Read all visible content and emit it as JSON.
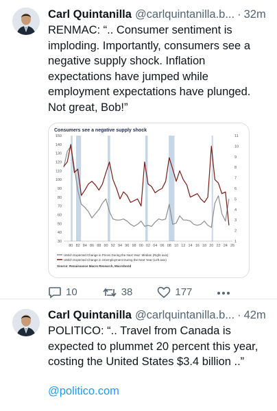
{
  "tweets": [
    {
      "author": "Carl Quintanilla",
      "handle": "@carlquintanilla.b...",
      "separator": "·",
      "time": "32m",
      "text": "RENMAC: “.. Consumer sentiment is imploding. Importantly, consumers see a negative supply shock. Inflation expectations have jumped while employment expectations have plunged. Not great, Bob!”",
      "stats": {
        "replies": "10",
        "reposts": "38",
        "likes": "177"
      },
      "more_icon": "more-dots-icon"
    },
    {
      "author": "Carl Quintanilla",
      "handle": "@carlquintanilla.b...",
      "separator": "·",
      "time": "42m",
      "text": "POLITICO: “.. Travel from Canada is expected to plummet 20 percent this year, costing the United States $3.4 billion ..”",
      "link": "@politico.com"
    }
  ],
  "chart_data": {
    "type": "line",
    "title": "Consumers see a negative supply shock",
    "x_tick_labels": [
      "80",
      "82",
      "84",
      "86",
      "88",
      "90",
      "92",
      "94",
      "96",
      "98",
      "00",
      "02",
      "04",
      "06",
      "08",
      "10",
      "12",
      "14",
      "16",
      "18",
      "20",
      "22",
      "24",
      "26"
    ],
    "left_axis": {
      "ticks": [
        30,
        40,
        50,
        60,
        70,
        80,
        90,
        100,
        110,
        120,
        130,
        140,
        150
      ],
      "range": [
        30,
        150
      ]
    },
    "right_axis": {
      "ticks": [
        1,
        2,
        3,
        4,
        5,
        6,
        7,
        8,
        9,
        10,
        11
      ],
      "range": [
        1,
        11
      ]
    },
    "recessions": [
      [
        1980.0,
        1980.5
      ],
      [
        1981.5,
        1982.9
      ],
      [
        1990.5,
        1991.2
      ],
      [
        2001.2,
        2001.9
      ],
      [
        2007.9,
        2009.5
      ],
      [
        2020.1,
        2020.4
      ]
    ],
    "x_range": [
      1978,
      2026
    ],
    "series": [
      {
        "name": "UMich Expected Change in Prices During the Next Year: Median (Right axis)",
        "color": "#8c8c8c",
        "axis": "right",
        "x": [
          1978,
          1979,
          1980,
          1981,
          1982,
          1983,
          1984,
          1985,
          1986,
          1987,
          1988,
          1989,
          1990,
          1991,
          1992,
          1993,
          1994,
          1995,
          1996,
          1997,
          1998,
          1999,
          2000,
          2001,
          2002,
          2003,
          2004,
          2005,
          2006,
          2007,
          2008,
          2009,
          2010,
          2011,
          2012,
          2013,
          2014,
          2015,
          2016,
          2017,
          2018,
          2019,
          2020,
          2021,
          2022,
          2023,
          2024,
          2025
        ],
        "y": [
          8.0,
          9.5,
          10.0,
          8.0,
          5.8,
          4.5,
          4.2,
          3.8,
          3.2,
          3.6,
          4.0,
          4.6,
          5.0,
          3.8,
          3.1,
          3.0,
          3.0,
          3.1,
          2.9,
          2.6,
          2.4,
          2.6,
          2.9,
          2.4,
          2.5,
          2.4,
          2.8,
          3.1,
          3.0,
          3.1,
          4.5,
          2.6,
          2.7,
          3.4,
          3.0,
          3.0,
          2.9,
          2.6,
          2.5,
          2.6,
          2.9,
          2.5,
          2.3,
          4.6,
          5.3,
          3.6,
          2.9,
          5.0
        ]
      },
      {
        "name": "UMich Expected Change in Unemployment During the Next Year (Left axis)",
        "color": "#7a1a12",
        "axis": "left",
        "x": [
          1978,
          1979,
          1980,
          1981,
          1982,
          1983,
          1984,
          1985,
          1986,
          1987,
          1988,
          1989,
          1990,
          1991,
          1992,
          1993,
          1994,
          1995,
          1996,
          1997,
          1998,
          1999,
          2000,
          2001,
          2002,
          2003,
          2004,
          2005,
          2006,
          2007,
          2008,
          2009,
          2010,
          2011,
          2012,
          2013,
          2014,
          2015,
          2016,
          2017,
          2018,
          2019,
          2020,
          2021,
          2022,
          2023,
          2024,
          2025
        ],
        "y": [
          115,
          120,
          140,
          108,
          112,
          82,
          88,
          95,
          98,
          94,
          88,
          95,
          108,
          120,
          100,
          90,
          78,
          86,
          82,
          74,
          76,
          78,
          70,
          120,
          95,
          92,
          85,
          88,
          90,
          98,
          125,
          112,
          98,
          110,
          100,
          94,
          80,
          82,
          84,
          78,
          74,
          80,
          138,
          100,
          96,
          84,
          86,
          48
        ]
      }
    ],
    "source": "Source: Renaissance Macro Research, Macrobond"
  }
}
